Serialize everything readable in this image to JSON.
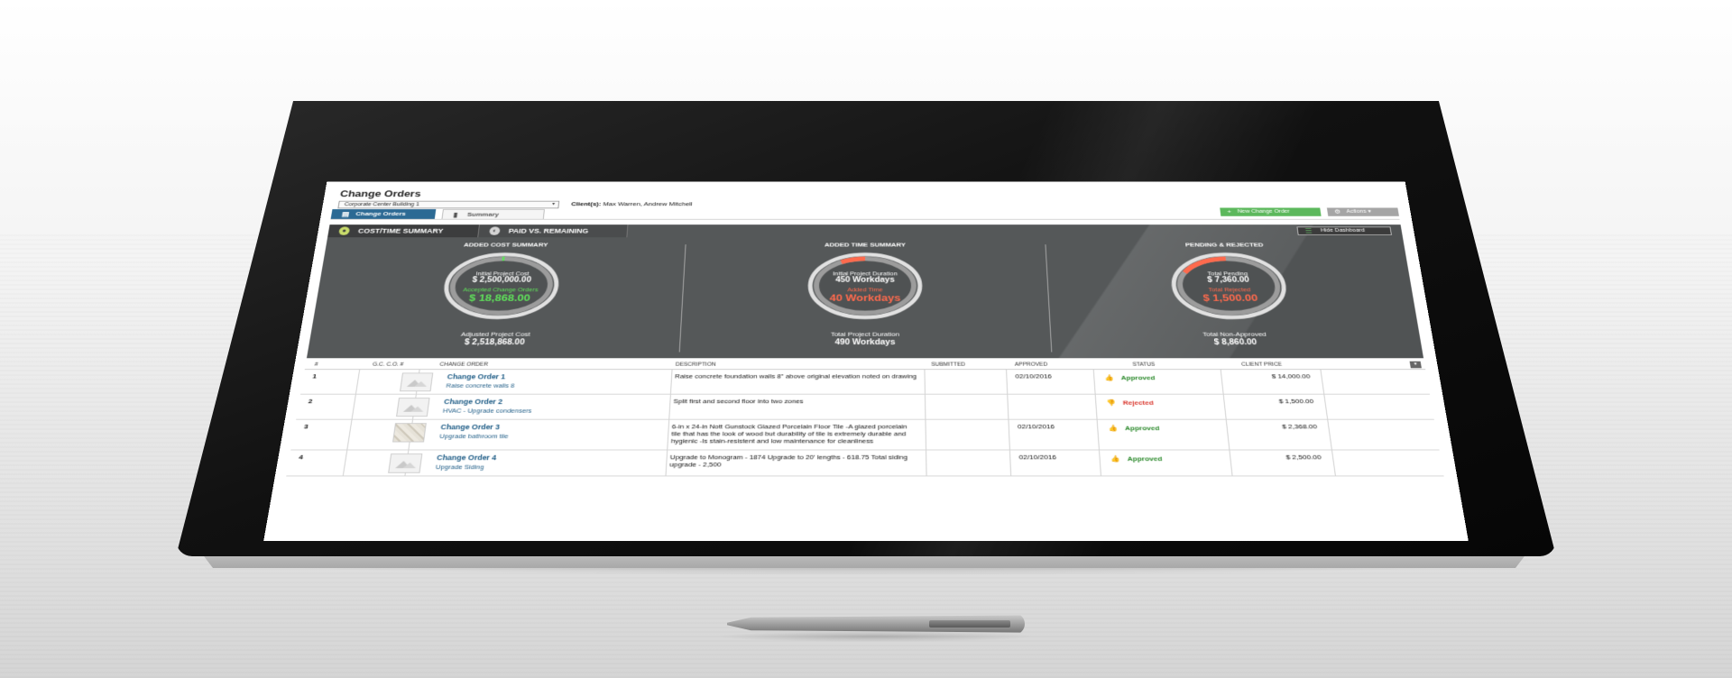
{
  "header": {
    "title": "Change Orders",
    "project_select": "Corporate Center Building 1",
    "client_label": "Client(s):",
    "client_names": "Max Warren, Andrew Mitchell"
  },
  "tabs": [
    {
      "label": "Change Orders",
      "active": true
    },
    {
      "label": "Summary",
      "active": false
    }
  ],
  "buttons": {
    "new_change_order": "New Change Order",
    "actions": "Actions",
    "hide_dashboard": "Hide Dashboard"
  },
  "dashboard": {
    "tabs": [
      {
        "label": "COST/TIME SUMMARY",
        "active": true
      },
      {
        "label": "PAID VS. REMAINING",
        "active": false
      }
    ],
    "panels": [
      {
        "title": "ADDED COST SUMMARY",
        "line1_label": "Initial Project Cost",
        "line1_value": "$ 2,500,000.00",
        "line2_label": "Accepted Change Orders",
        "line2_value": "$ 18,868.00",
        "line2_color": "#5fe25a",
        "foot_label": "Adjusted Project Cost",
        "foot_value": "$ 2,518,868.00",
        "arc_fraction": 0.0075,
        "arc_color": "#5fe25a"
      },
      {
        "title": "ADDED TIME SUMMARY",
        "line1_label": "Initial Project Duration",
        "line1_value": "450 Workdays",
        "line2_label": "Added Time",
        "line2_value": "40 Workdays",
        "line2_color": "#ff6a4d",
        "foot_label": "Total Project Duration",
        "foot_value": "490 Workdays",
        "arc_fraction": 0.082,
        "arc_color": "#ff6a4d"
      },
      {
        "title": "PENDING & REJECTED",
        "line1_label": "Total Pending",
        "line1_value": "$ 7,360.00",
        "line2_label": "Total Rejected",
        "line2_value": "$ 1,500.00",
        "line2_color": "#ff6a4d",
        "foot_label": "Total Non-Approved",
        "foot_value": "$ 8,860.00",
        "arc_fraction": 0.17,
        "arc_color": "#ff6a4d"
      }
    ]
  },
  "table": {
    "columns": [
      "#",
      "G.C. C.O. #",
      "CHANGE ORDER",
      "DESCRIPTION",
      "SUBMITTED",
      "APPROVED",
      "STATUS",
      "CLIENT PRICE"
    ],
    "rows": [
      {
        "num": "1",
        "gc": "",
        "title": "Change Order 1",
        "subtitle": "Raise concrete walls 8",
        "description": "Raise concrete foundation walls 8'' above original elevation noted on drawing",
        "submitted": "",
        "approved": "02/10/2016",
        "status": "Approved",
        "status_color": "#2c8a2c",
        "price": "$ 14,000.00",
        "thumb": "placeholder"
      },
      {
        "num": "2",
        "gc": "",
        "title": "Change Order 2",
        "subtitle": "HVAC - Upgrade condensers",
        "description": "Split first and second floor into two zones",
        "submitted": "",
        "approved": "",
        "status": "Rejected",
        "status_color": "#d9352b",
        "price": "$ 1,500.00",
        "thumb": "placeholder"
      },
      {
        "num": "3",
        "gc": "",
        "title": "Change Order 3",
        "subtitle": "Upgrade bathroom tile",
        "description": "6-in x 24-in Nott Gunstock Glazed Porcelain Floor Tile -A glazed porcelain tile that has the look of wood but durability of tile is extremely durable and hygienic -Is stain-resistent and low maintenance for cleanliness",
        "submitted": "",
        "approved": "02/10/2016",
        "status": "Approved",
        "status_color": "#2c8a2c",
        "price": "$ 2,368.00",
        "thumb": "tile"
      },
      {
        "num": "4",
        "gc": "",
        "title": "Change Order 4",
        "subtitle": "Upgrade Siding",
        "description": "Upgrade to Monogram - 1874 Upgrade to 20' lengths - 618.75 Total siding upgrade - 2,500",
        "submitted": "",
        "approved": "02/10/2016",
        "status": "Approved",
        "status_color": "#2c8a2c",
        "price": "$ 2,500.00",
        "thumb": "placeholder"
      }
    ]
  },
  "icons": {
    "change_orders_tab": "document-icon",
    "summary_tab": "bar-chart-icon",
    "new": "plus-icon",
    "actions": "gear-icon",
    "hide": "menu-icon",
    "approved": "thumbs-up-icon",
    "rejected": "thumbs-down-icon"
  }
}
